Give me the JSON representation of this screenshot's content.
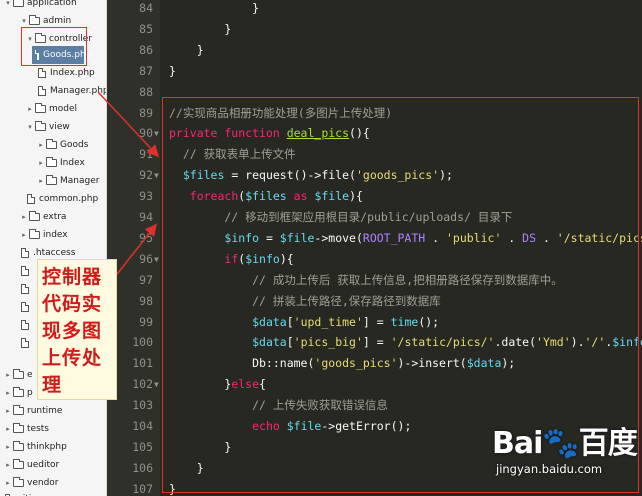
{
  "sidebar": {
    "items": [
      {
        "label": "application",
        "type": "folder",
        "indent": 0,
        "arrow": "▾"
      },
      {
        "label": "admin",
        "type": "folder",
        "indent": 1,
        "arrow": "▾"
      },
      {
        "label": "controller",
        "type": "folder",
        "indent": 2,
        "arrow": "▾"
      },
      {
        "label": "Goods.php",
        "type": "file",
        "indent": 3,
        "selected": true
      },
      {
        "label": "Index.php",
        "type": "file",
        "indent": 3
      },
      {
        "label": "Manager.php",
        "type": "file",
        "indent": 3
      },
      {
        "label": "model",
        "type": "folder",
        "indent": 2,
        "arrow": "▸"
      },
      {
        "label": "view",
        "type": "folder",
        "indent": 2,
        "arrow": "▾"
      },
      {
        "label": "Goods",
        "type": "folder",
        "indent": 3,
        "arrow": "▸"
      },
      {
        "label": "Index",
        "type": "folder",
        "indent": 3,
        "arrow": "▸"
      },
      {
        "label": "Manager",
        "type": "folder",
        "indent": 3,
        "arrow": "▸"
      },
      {
        "label": "common.php",
        "type": "file",
        "indent": 2
      },
      {
        "label": "extra",
        "type": "folder",
        "indent": 1,
        "arrow": "▸"
      },
      {
        "label": "index",
        "type": "folder",
        "indent": 1,
        "arrow": "▸"
      },
      {
        "label": ".htaccess",
        "type": "file",
        "indent": 1
      },
      {
        "label": "",
        "type": "file",
        "indent": 1
      },
      {
        "label": "",
        "type": "file",
        "indent": 1
      },
      {
        "label": "",
        "type": "file",
        "indent": 1
      },
      {
        "label": "",
        "type": "file",
        "indent": 1
      },
      {
        "label": "",
        "type": "file",
        "indent": 1
      },
      {
        "label": "e",
        "type": "folder",
        "indent": 0,
        "arrow": "▸"
      },
      {
        "label": "p",
        "type": "folder",
        "indent": 0,
        "arrow": "▸"
      },
      {
        "label": "runtime",
        "type": "folder",
        "indent": 0,
        "arrow": "▸"
      },
      {
        "label": "tests",
        "type": "folder",
        "indent": 0,
        "arrow": "▸"
      },
      {
        "label": "thinkphp",
        "type": "folder",
        "indent": 0,
        "arrow": "▸"
      },
      {
        "label": "ueditor",
        "type": "folder",
        "indent": 0,
        "arrow": "▸"
      },
      {
        "label": "vendor",
        "type": "folder",
        "indent": 0,
        "arrow": "▸"
      },
      {
        "label": "gitignore",
        "type": "file",
        "indent": 0
      }
    ]
  },
  "annotation": {
    "text": "控制器代码实现多图上传处理"
  },
  "editor": {
    "lines": [
      {
        "num": "84",
        "fold": "",
        "segs": [
          {
            "t": "            }",
            "c": ""
          }
        ]
      },
      {
        "num": "85",
        "fold": "",
        "segs": [
          {
            "t": "        }",
            "c": ""
          }
        ]
      },
      {
        "num": "86",
        "fold": "",
        "segs": [
          {
            "t": "    }",
            "c": ""
          }
        ]
      },
      {
        "num": "87",
        "fold": "",
        "segs": [
          {
            "t": "}",
            "c": ""
          }
        ]
      },
      {
        "num": "88",
        "fold": "",
        "segs": [
          {
            "t": "",
            "c": ""
          }
        ]
      },
      {
        "num": "89",
        "fold": "",
        "segs": [
          {
            "t": "//实现商品相册功能处理(多图片上传处理)",
            "c": "c-com"
          }
        ]
      },
      {
        "num": "90",
        "fold": "▼",
        "segs": [
          {
            "t": "private function ",
            "c": "c-kw"
          },
          {
            "t": "deal_pics",
            "c": "c-fname"
          },
          {
            "t": "(){",
            "c": ""
          }
        ]
      },
      {
        "num": "91",
        "fold": "",
        "segs": [
          {
            "t": "  // 获取表单上传文件",
            "c": "c-com"
          }
        ]
      },
      {
        "num": "92",
        "fold": "▼",
        "segs": [
          {
            "t": "  ",
            "c": ""
          },
          {
            "t": "$files",
            "c": "c-var"
          },
          {
            "t": " = request()->file(",
            "c": ""
          },
          {
            "t": "'goods_pics'",
            "c": "c-str"
          },
          {
            "t": ");",
            "c": ""
          }
        ]
      },
      {
        "num": "93",
        "fold": "",
        "segs": [
          {
            "t": "   ",
            "c": ""
          },
          {
            "t": "foreach",
            "c": "c-kw"
          },
          {
            "t": "(",
            "c": ""
          },
          {
            "t": "$files",
            "c": "c-var"
          },
          {
            "t": " as ",
            "c": "c-kw"
          },
          {
            "t": "$file",
            "c": "c-var"
          },
          {
            "t": "){",
            "c": ""
          }
        ]
      },
      {
        "num": "94",
        "fold": "",
        "segs": [
          {
            "t": "        // 移动到框架应用根目录/public/uploads/ 目录下",
            "c": "c-com"
          }
        ]
      },
      {
        "num": "95",
        "fold": "",
        "segs": [
          {
            "t": "        ",
            "c": ""
          },
          {
            "t": "$info",
            "c": "c-var"
          },
          {
            "t": " = ",
            "c": ""
          },
          {
            "t": "$file",
            "c": "c-var"
          },
          {
            "t": "->move(",
            "c": ""
          },
          {
            "t": "ROOT_PATH",
            "c": "c-const"
          },
          {
            "t": " . ",
            "c": ""
          },
          {
            "t": "'public'",
            "c": "c-str"
          },
          {
            "t": " . ",
            "c": ""
          },
          {
            "t": "DS",
            "c": "c-const"
          },
          {
            "t": " . ",
            "c": ""
          },
          {
            "t": "'/static/pics/'",
            "c": "c-str"
          },
          {
            "t": ");",
            "c": ""
          }
        ]
      },
      {
        "num": "96",
        "fold": "▼",
        "segs": [
          {
            "t": "        ",
            "c": ""
          },
          {
            "t": "if",
            "c": "c-kw"
          },
          {
            "t": "(",
            "c": ""
          },
          {
            "t": "$info",
            "c": "c-var"
          },
          {
            "t": "){",
            "c": ""
          }
        ]
      },
      {
        "num": "97",
        "fold": "",
        "segs": [
          {
            "t": "            // 成功上传后 获取上传信息,把相册路径保存到数据库中。",
            "c": "c-com"
          }
        ]
      },
      {
        "num": "98",
        "fold": "",
        "segs": [
          {
            "t": "            // 拼装上传路径,保存路径到数据库",
            "c": "c-com"
          }
        ]
      },
      {
        "num": "99",
        "fold": "",
        "segs": [
          {
            "t": "            ",
            "c": ""
          },
          {
            "t": "$data",
            "c": "c-var"
          },
          {
            "t": "[",
            "c": ""
          },
          {
            "t": "'upd_time'",
            "c": "c-str"
          },
          {
            "t": "] = ",
            "c": ""
          },
          {
            "t": "time",
            "c": "c-var"
          },
          {
            "t": "();",
            "c": ""
          }
        ]
      },
      {
        "num": "100",
        "fold": "",
        "segs": [
          {
            "t": "            ",
            "c": ""
          },
          {
            "t": "$data",
            "c": "c-var"
          },
          {
            "t": "[",
            "c": ""
          },
          {
            "t": "'pics_big'",
            "c": "c-str"
          },
          {
            "t": "] = ",
            "c": ""
          },
          {
            "t": "'/static/pics/'",
            "c": "c-str"
          },
          {
            "t": ".date(",
            "c": ""
          },
          {
            "t": "'Ymd'",
            "c": "c-str"
          },
          {
            "t": ").",
            "c": ""
          },
          {
            "t": "'/'",
            "c": "c-str"
          },
          {
            "t": ".",
            "c": ""
          },
          {
            "t": "$info",
            "c": "c-var"
          },
          {
            "t": "->getFilename();",
            "c": ""
          }
        ]
      },
      {
        "num": "101",
        "fold": "",
        "segs": [
          {
            "t": "            Db::name(",
            "c": ""
          },
          {
            "t": "'goods_pics'",
            "c": "c-str"
          },
          {
            "t": ")->insert(",
            "c": ""
          },
          {
            "t": "$data",
            "c": "c-var"
          },
          {
            "t": ");",
            "c": ""
          }
        ]
      },
      {
        "num": "102",
        "fold": "▼",
        "segs": [
          {
            "t": "        }",
            "c": ""
          },
          {
            "t": "else",
            "c": "c-kw"
          },
          {
            "t": "{",
            "c": ""
          }
        ]
      },
      {
        "num": "103",
        "fold": "",
        "segs": [
          {
            "t": "            // 上传失败获取错误信息",
            "c": "c-com"
          }
        ]
      },
      {
        "num": "104",
        "fold": "",
        "segs": [
          {
            "t": "            ",
            "c": ""
          },
          {
            "t": "echo",
            "c": "c-kw"
          },
          {
            "t": " ",
            "c": ""
          },
          {
            "t": "$file",
            "c": "c-var"
          },
          {
            "t": "->getError();",
            "c": ""
          }
        ]
      },
      {
        "num": "105",
        "fold": "",
        "segs": [
          {
            "t": "        }",
            "c": ""
          }
        ]
      },
      {
        "num": "106",
        "fold": "",
        "segs": [
          {
            "t": "    }",
            "c": ""
          }
        ]
      },
      {
        "num": "107",
        "fold": "",
        "segs": [
          {
            "t": "}",
            "c": ""
          }
        ]
      }
    ]
  },
  "watermark": {
    "logo": "Bai🐾百度",
    "url": "jingyan.baidu.com"
  }
}
